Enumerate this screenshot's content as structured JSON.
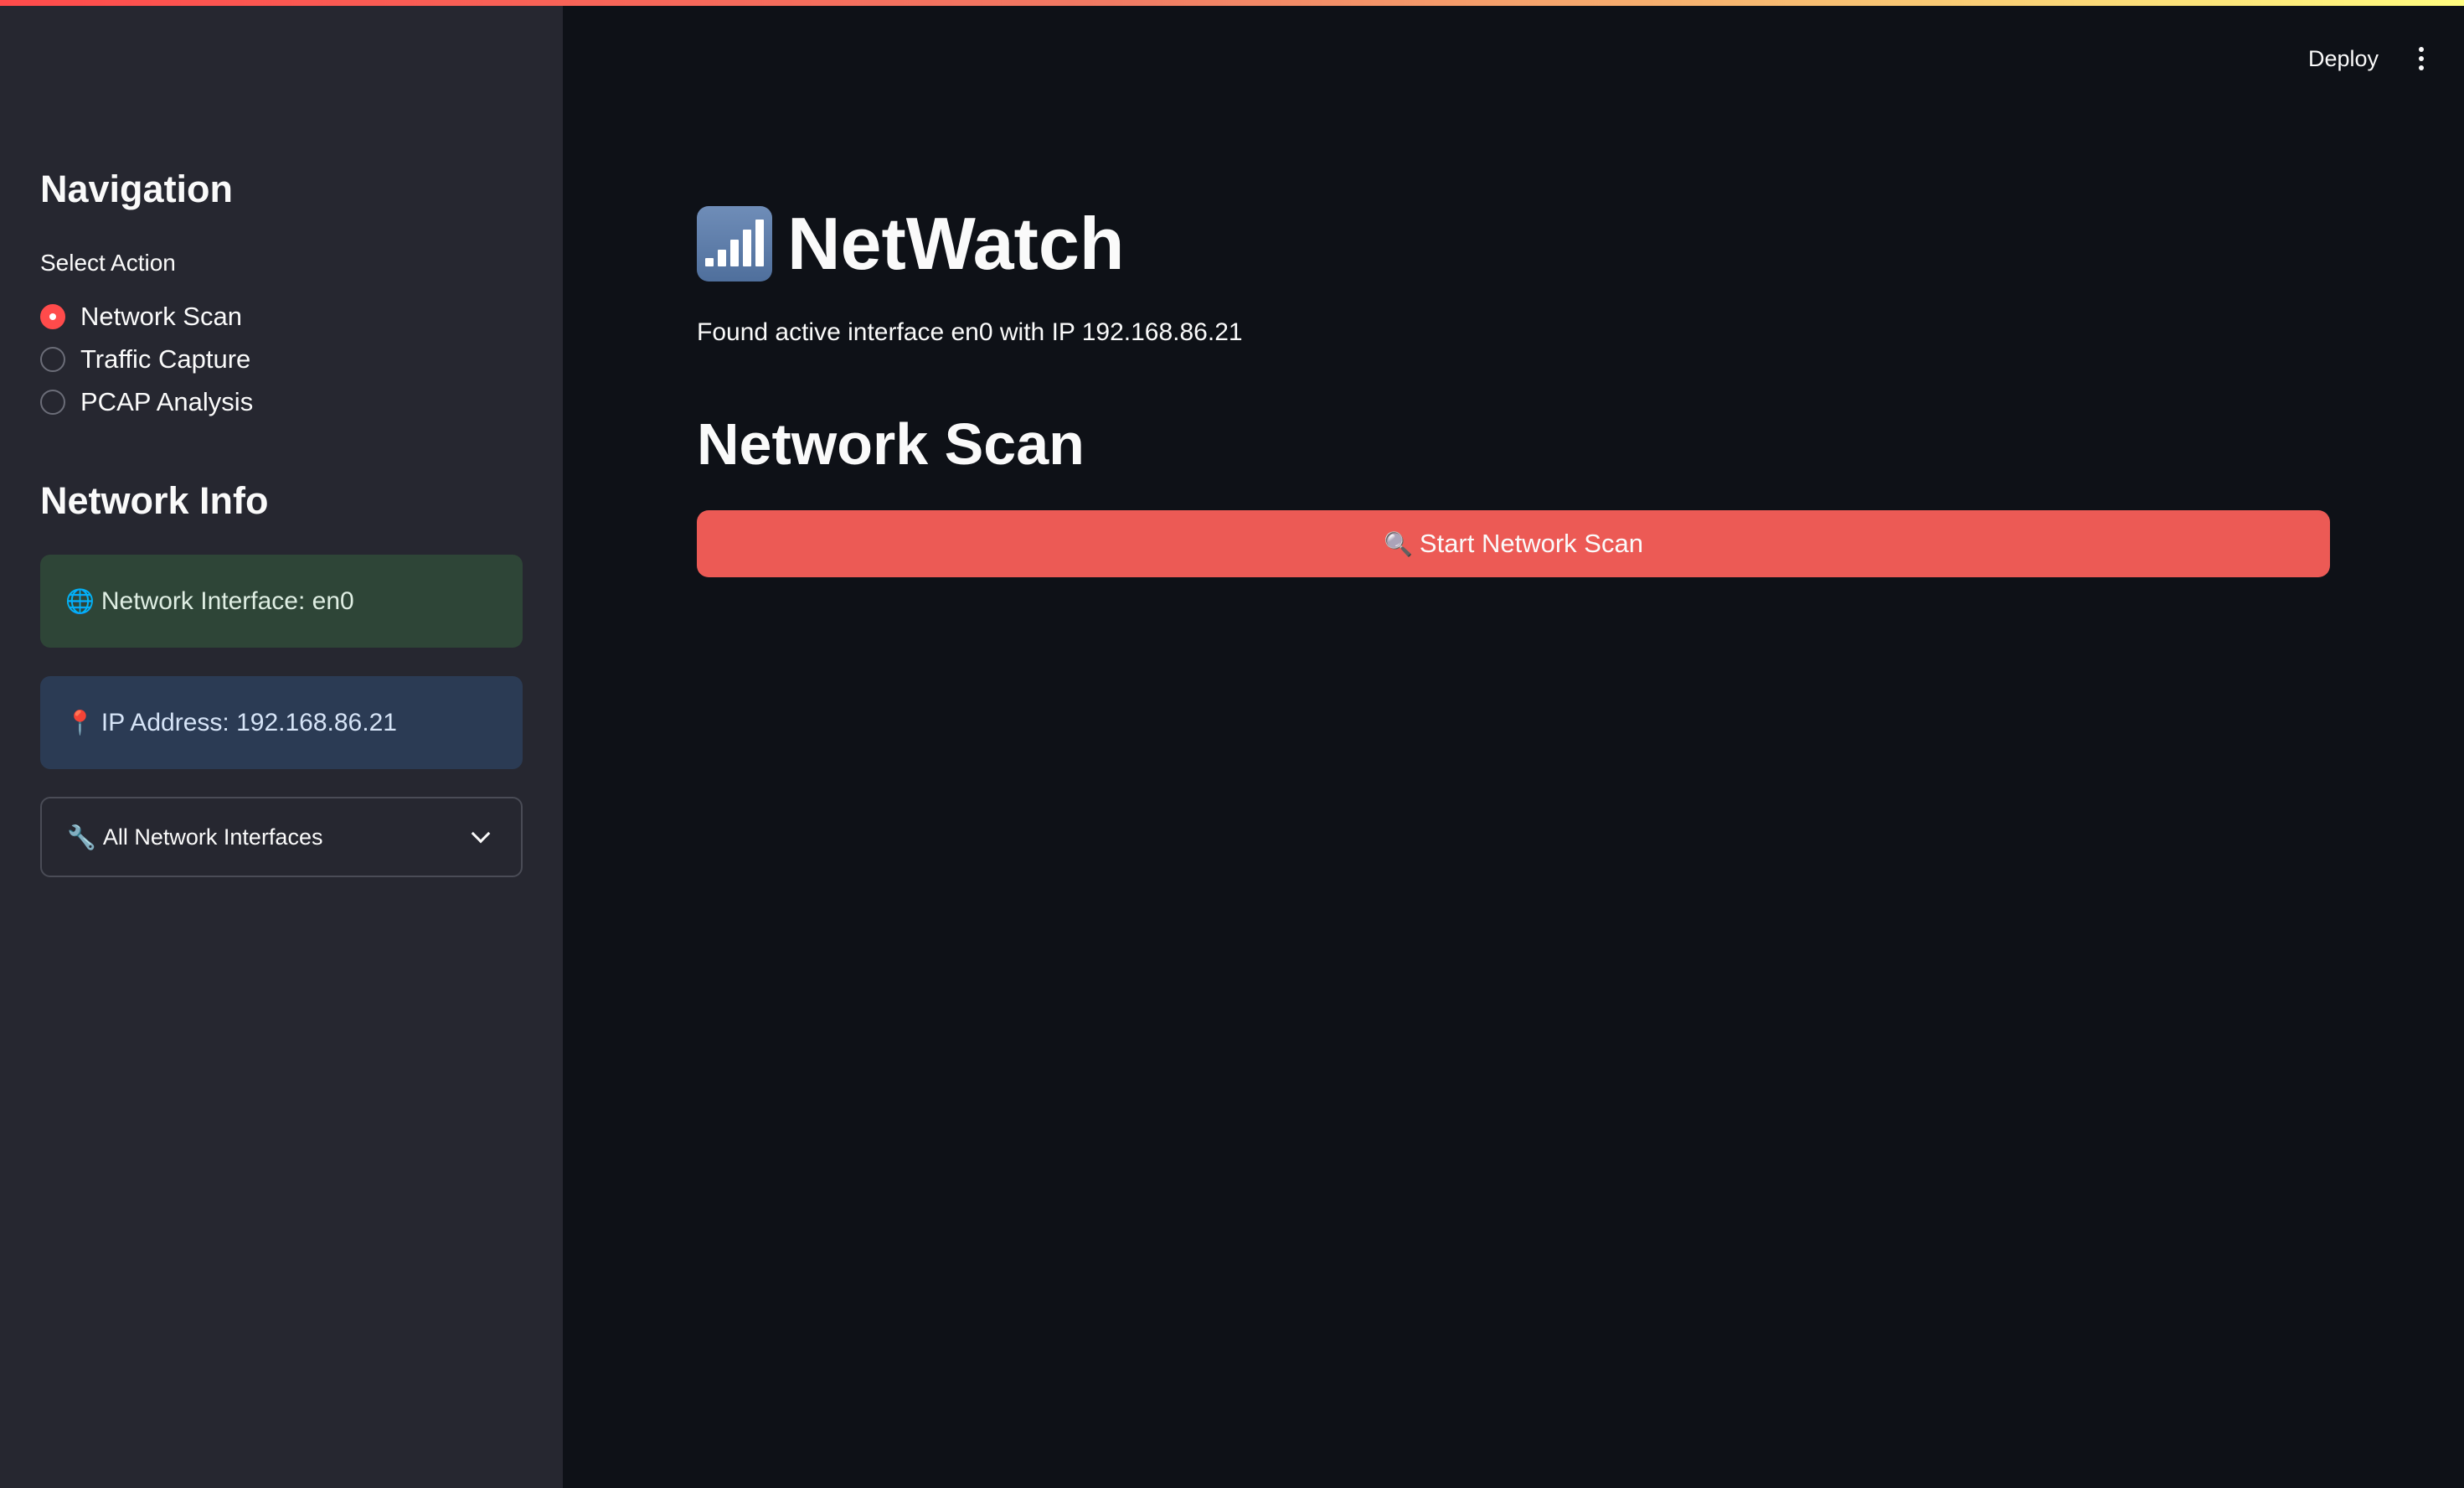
{
  "header": {
    "deploy_label": "Deploy",
    "menu_icon": "kebab-menu-icon"
  },
  "sidebar": {
    "nav_title": "Navigation",
    "radio_label": "Select Action",
    "options": [
      {
        "label": "Network Scan",
        "selected": true
      },
      {
        "label": "Traffic Capture",
        "selected": false
      },
      {
        "label": "PCAP Analysis",
        "selected": false
      }
    ],
    "network_info_title": "Network Info",
    "interface_box": {
      "icon": "🌐",
      "text": "Network Interface: en0"
    },
    "ip_box": {
      "icon": "📍",
      "text": "IP Address: 192.168.86.21"
    },
    "expander": {
      "icon": "🔧",
      "label": "All Network Interfaces"
    }
  },
  "main": {
    "title": "NetWatch",
    "title_icon": "signal-bars-icon",
    "status": "Found active interface en0 with IP 192.168.86.21",
    "section_title": "Network Scan",
    "scan_button": {
      "icon": "🔍",
      "label": "Start Network Scan"
    }
  },
  "colors": {
    "accent": "#ff4b4b",
    "sidebar_bg": "#262730",
    "main_bg": "#0e1117",
    "success_bg": "#2e4537",
    "info_bg": "#2b3b54",
    "button_bg": "#ec5a55"
  }
}
